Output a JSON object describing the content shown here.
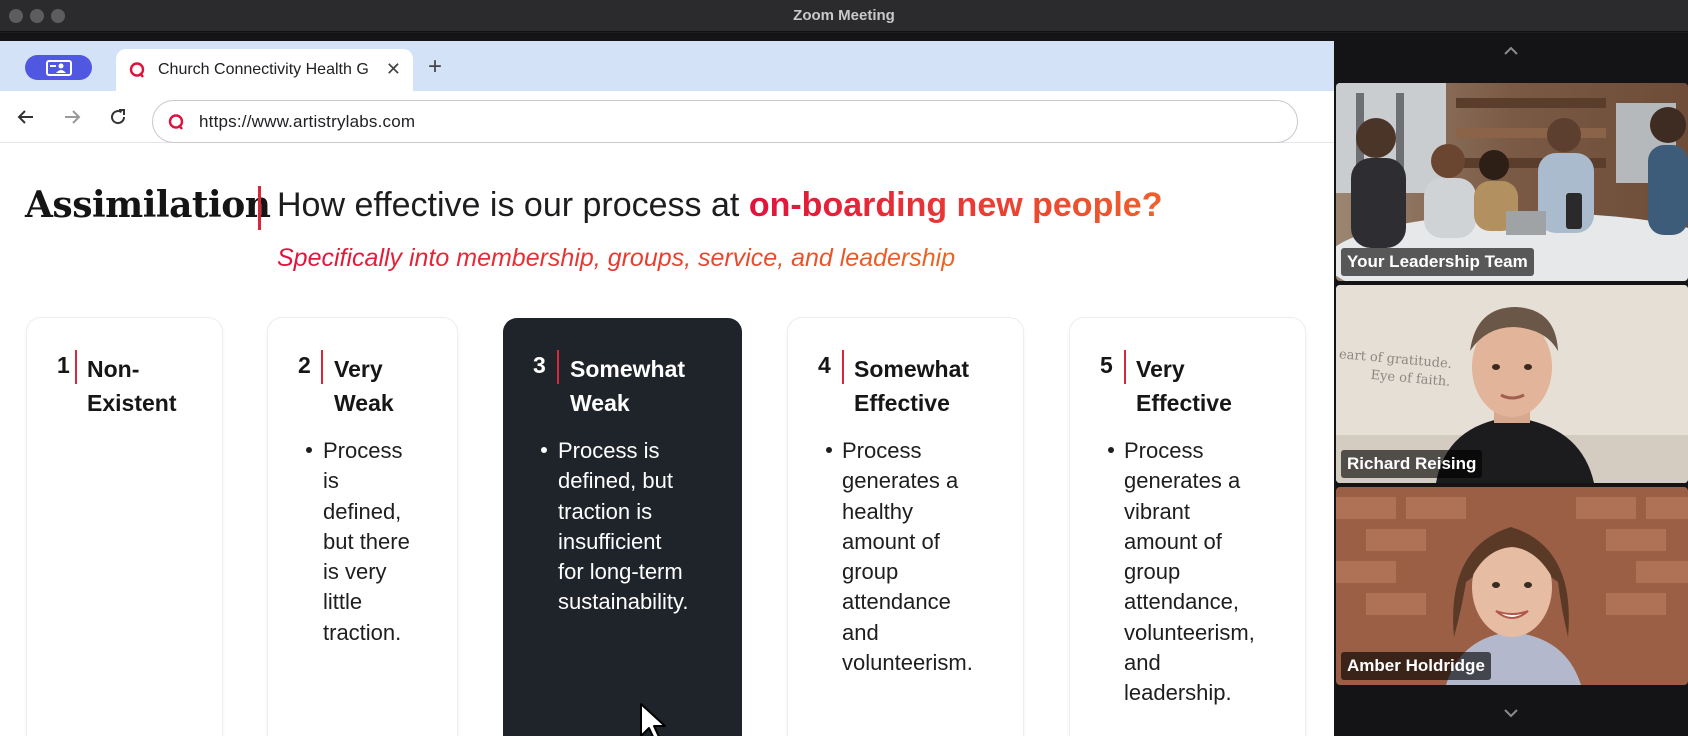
{
  "window": {
    "title": "Zoom Meeting"
  },
  "browser": {
    "tab": {
      "title": "Church Connectivity Health G",
      "close": "✕"
    },
    "new_tab": "+",
    "url": "https://www.artistrylabs.com"
  },
  "slide": {
    "heading_word": "Assimilation",
    "question_prefix": "How effective is our process at ",
    "question_highlight": "on-boarding new people?",
    "subheading": "Specifically into membership, groups, service, and leadership",
    "cards": [
      {
        "number": "1",
        "title": "Non-\nExistent",
        "bullet": ""
      },
      {
        "number": "2",
        "title": "Very\nWeak",
        "bullet": "Process\nis\ndefined,\nbut there\nis very\nlittle\ntraction."
      },
      {
        "number": "3",
        "title": "Somewhat\nWeak",
        "bullet": "Process is\ndefined, but\ntraction is\ninsufficient\nfor long-term\nsustainability.",
        "selected": true
      },
      {
        "number": "4",
        "title": "Somewhat\nEffective",
        "bullet": "Process\ngenerates a\nhealthy\namount of\ngroup\nattendance\nand\nvolunteerism."
      },
      {
        "number": "5",
        "title": "Very\nEffective",
        "bullet": "Process\ngenerates a\nvibrant\namount of\ngroup\nattendance,\nvolunteerism,\nand\nleadership."
      }
    ]
  },
  "participants": [
    {
      "name": "Your Leadership Team"
    },
    {
      "name": "Richard Reising",
      "active_speaker": true,
      "wall_text": "eart of gratitude.\nEye of faith."
    },
    {
      "name": "Amber Holdridge"
    }
  ],
  "colors": {
    "accent": "#d7263d",
    "gradient_end": "#f0602b",
    "active_card": "#1f242a",
    "active_speaker_border": "#5bd6ad"
  }
}
